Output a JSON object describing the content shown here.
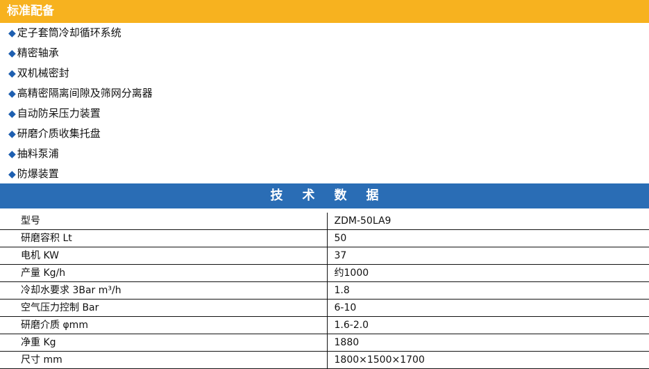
{
  "standard_config": {
    "title": "标准配备",
    "marker": "◆",
    "items": [
      "定子套筒冷却循环系统",
      "精密轴承",
      "双机械密封",
      "高精密隔离间隙及筛网分离器",
      "自动防呆压力装置",
      "研磨介质收集托盘",
      "抽料泵浦",
      "防爆装置"
    ]
  },
  "tech_data": {
    "title": "技术数据",
    "rows": [
      {
        "label": "型号",
        "value": "ZDM-50LA9"
      },
      {
        "label": "研磨容积 Lt",
        "value": "50"
      },
      {
        "label": "电机 KW",
        "value": "37"
      },
      {
        "label": "产量 Kg/h",
        "value": "约1000"
      },
      {
        "label": "冷却水要求 3Bar m³/h",
        "value": "1.8"
      },
      {
        "label": "空气压力控制 Bar",
        "value": "6-10"
      },
      {
        "label": "研磨介质 φmm",
        "value": "1.6-2.0"
      },
      {
        "label": "净重 Kg",
        "value": "1880"
      },
      {
        "label": "尺寸 mm",
        "value": "1800×1500×1700"
      }
    ]
  },
  "colors": {
    "header_orange": "#f7b21f",
    "spec_blue": "#2a6db5",
    "diamond_blue": "#1e5fb0"
  }
}
